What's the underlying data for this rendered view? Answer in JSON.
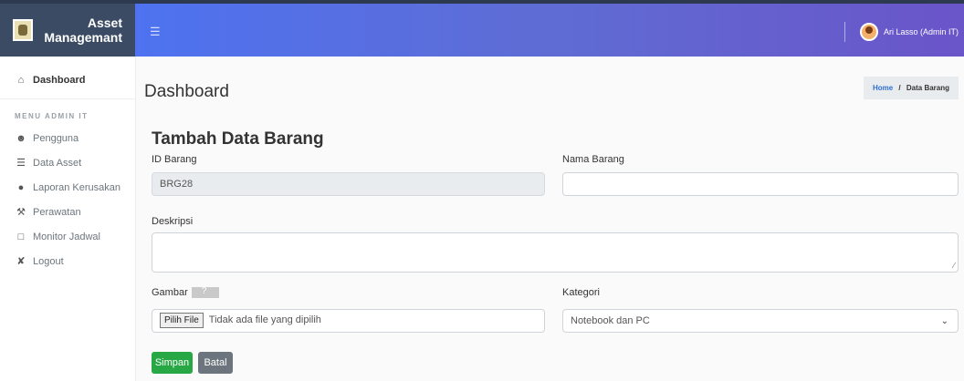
{
  "brand": {
    "line1": "Asset",
    "line2": "Managemant"
  },
  "header": {
    "user_name": "Ari Lasso (Admin IT)"
  },
  "sidebar": {
    "dashboard_label": "Dashboard",
    "section_title": "MENU ADMIN IT",
    "items": [
      {
        "label": "Pengguna",
        "icon": "users-icon"
      },
      {
        "label": "Data Asset",
        "icon": "database-icon"
      },
      {
        "label": "Laporan Kerusakan",
        "icon": "info-circle-icon"
      },
      {
        "label": "Perawatan",
        "icon": "wrench-icon"
      },
      {
        "label": "Monitor Jadwal",
        "icon": "clipboard-icon"
      },
      {
        "label": "Logout",
        "icon": "logout-icon"
      }
    ]
  },
  "page": {
    "title": "Dashboard",
    "breadcrumb": {
      "home": "Home",
      "separator": "/",
      "current": "Data Barang"
    }
  },
  "form": {
    "title": "Tambah Data Barang",
    "id_label": "ID Barang",
    "id_value": "BRG28",
    "name_label": "Nama Barang",
    "name_value": "",
    "desc_label": "Deskripsi",
    "desc_value": "",
    "image_label": "Gambar",
    "file_button": "Pilih File",
    "file_status": "Tidak ada file yang dipilih",
    "category_label": "Kategori",
    "category_value": "Notebook dan PC",
    "save_button": "Simpan",
    "cancel_button": "Batal"
  },
  "colors": {
    "sidebar_brand": "#3c4b64",
    "topbar_start": "#4e72f0",
    "save": "#28a745",
    "cancel": "#6c757d"
  }
}
